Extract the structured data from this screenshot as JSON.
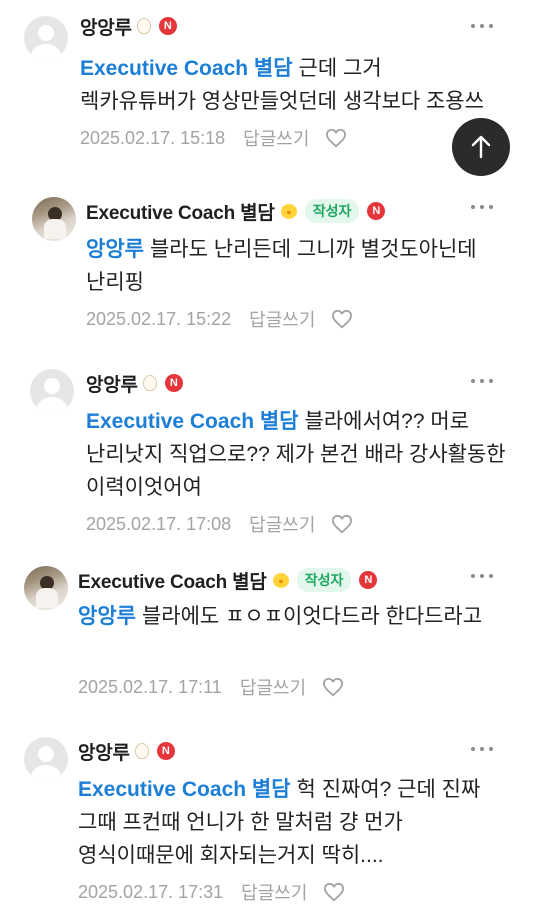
{
  "comments": [
    {
      "author": "앙앙루",
      "mention": "Executive Coach 별담",
      "text": "근데 그거 렉카유튜버가 영상만들엇던데 생각보다 조용쓰",
      "date": "2025.02.17. 15:18",
      "reply_label": "답글쓰기"
    },
    {
      "author": "Executive Coach 별담",
      "author_badge": "작성자",
      "mention": "앙앙루",
      "text": "블라도 난리든데 그니까 별것도아닌데 난리핑",
      "date": "2025.02.17. 15:22",
      "reply_label": "답글쓰기"
    },
    {
      "author": "앙앙루",
      "mention": "Executive Coach 별담",
      "text": "블라에서여?? 머로 난리낫지 직업으로?? 제가 본건 배라 강사활동한 이력이엇어여",
      "date": "2025.02.17. 17:08",
      "reply_label": "답글쓰기"
    },
    {
      "author": "Executive Coach 별담",
      "author_badge": "작성자",
      "mention": "앙앙루",
      "text": "블라에도 ㅍㅇㅍ이엇다드라 한다드라고",
      "date": "2025.02.17. 17:11",
      "reply_label": "답글쓰기"
    },
    {
      "author": "앙앙루",
      "mention": "Executive Coach 별담",
      "text": "헉 진짜여? 근데 진짜 그때 프컨때 언니가 한 말처럼 걍 먼가 영식이때문에 회자되는거지 딱히....",
      "date": "2025.02.17. 17:31",
      "reply_label": "답글쓰기"
    }
  ],
  "badge_n": "N",
  "icons": {
    "more": "more-dots-icon",
    "like": "heart-icon",
    "scroll_top": "arrow-up-icon",
    "level_egg": "egg-icon",
    "level_chick": "chick-icon"
  },
  "colors": {
    "mention": "#1c7ed6",
    "meta": "#a3a3a3",
    "author_badge_text": "#1ea862",
    "author_badge_bg": "#e4f7ec",
    "n_badge": "#e5373b",
    "scroll_button": "#2b2b2b"
  }
}
